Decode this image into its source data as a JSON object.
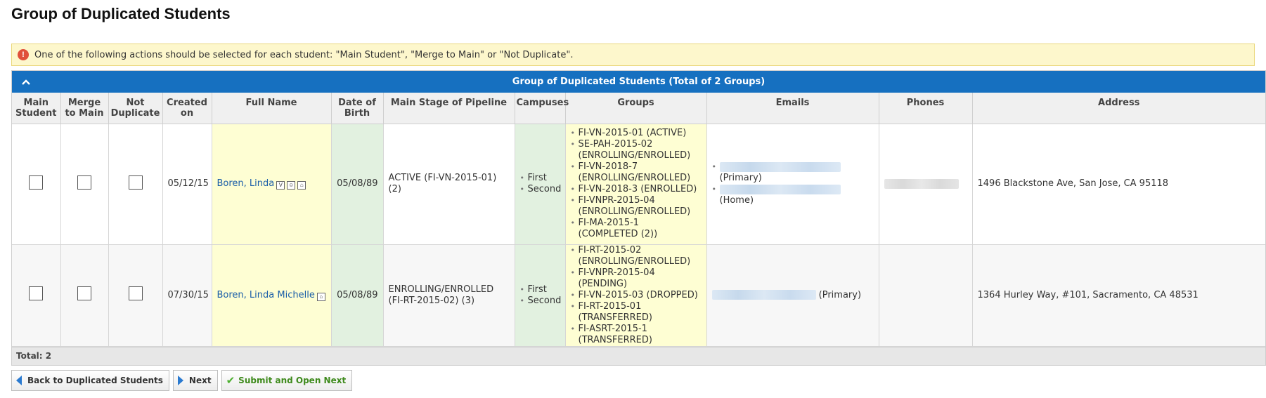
{
  "page": {
    "title": "Group of Duplicated Students"
  },
  "alert": {
    "icon": "alert-circle-icon",
    "icon_glyph": "!",
    "text": "One of the following actions should be selected for each student: \"Main Student\", \"Merge to Main\" or \"Not Duplicate\"."
  },
  "grid": {
    "title": "Group of Duplicated Students (Total of 2 Groups)",
    "header_color": "#1670c0",
    "columns": {
      "main_student": "Main Student",
      "merge_to_main": "Merge to Main",
      "not_duplicate": "Not Duplicate",
      "created_on": "Created on",
      "full_name": "Full Name",
      "date_of_birth": "Date of Birth",
      "main_stage": "Main Stage of Pipeline",
      "campuses": "Campuses",
      "groups": "Groups",
      "emails": "Emails",
      "phones": "Phones",
      "address": "Address"
    },
    "rows": [
      {
        "main_student": false,
        "merge_to_main": false,
        "not_duplicate": false,
        "created_on": "05/12/15",
        "full_name": "Boren, Linda",
        "name_icons": [
          {
            "name": "verified-icon",
            "glyph": "V"
          },
          {
            "name": "person-icon",
            "glyph": "☺"
          },
          {
            "name": "home-icon",
            "glyph": "⌂"
          }
        ],
        "date_of_birth": "05/08/89",
        "main_stage": "ACTIVE (FI-VN-2015-01) (2)",
        "campuses": [
          "First",
          "Second"
        ],
        "groups": [
          "FI-VN-2015-01 (ACTIVE)",
          "SE-PAH-2015-02 (ENROLLING/ENROLLED)",
          "FI-VN-2018-7 (ENROLLING/ENROLLED)",
          "FI-VN-2018-3 (ENROLLED)",
          "FI-VNPR-2015-04 (ENROLLING/ENROLLED)",
          "FI-MA-2015-1 (COMPLETED (2))"
        ],
        "emails": [
          "(Primary)",
          "(Home)"
        ],
        "phones_redacted": true,
        "address": "1496 Blackstone Ave, San Jose, CA 95118"
      },
      {
        "main_student": false,
        "merge_to_main": false,
        "not_duplicate": false,
        "created_on": "07/30/15",
        "full_name": "Boren, Linda Michelle",
        "name_icons": [
          {
            "name": "home-icon",
            "glyph": "⌂"
          }
        ],
        "date_of_birth": "05/08/89",
        "main_stage": "ENROLLING/ENROLLED (FI-RT-2015-02) (3)",
        "campuses": [
          "First",
          "Second"
        ],
        "groups": [
          "FI-RT-2015-02 (ENROLLING/ENROLLED)",
          "FI-VNPR-2015-04 (PENDING)",
          "FI-VN-2015-03 (DROPPED)",
          "FI-RT-2015-01 (TRANSFERRED)",
          "FI-ASRT-2015-1 (TRANSFERRED)"
        ],
        "emails": [
          "(Primary)"
        ],
        "phones_redacted": false,
        "address": "1364 Hurley Way, #101, Sacramento, CA 48531"
      }
    ],
    "total_label": "Total: 2"
  },
  "buttons": {
    "back": {
      "label": "Back to Duplicated Students",
      "icon": "arrow-left-icon"
    },
    "next": {
      "label": "Next",
      "icon": "arrow-right-icon"
    },
    "submit": {
      "label": "Submit and Open Next",
      "icon": "checkmark-icon",
      "glyph": "✔"
    }
  }
}
